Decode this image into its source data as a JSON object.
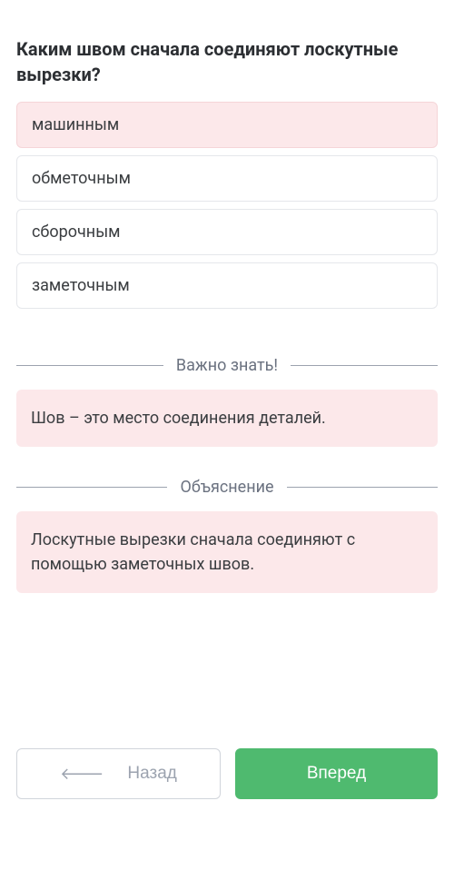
{
  "question": {
    "title": "Каким швом сначала соединяют лоскутные вырезки?"
  },
  "options": [
    {
      "label": "машинным",
      "highlighted": true
    },
    {
      "label": "обметочным",
      "highlighted": false
    },
    {
      "label": "сборочным",
      "highlighted": false
    },
    {
      "label": "заметочным",
      "highlighted": false
    }
  ],
  "sections": {
    "important": {
      "label": "Важно знать!",
      "text": "Шов – это место соединения деталей."
    },
    "explanation": {
      "label": "Объяснение",
      "text": "Лоскутные вырезки сначала соединяют с помощью заметочных швов."
    }
  },
  "nav": {
    "back": "Назад",
    "forward": "Вперед",
    "back_arrow": "🡐"
  }
}
